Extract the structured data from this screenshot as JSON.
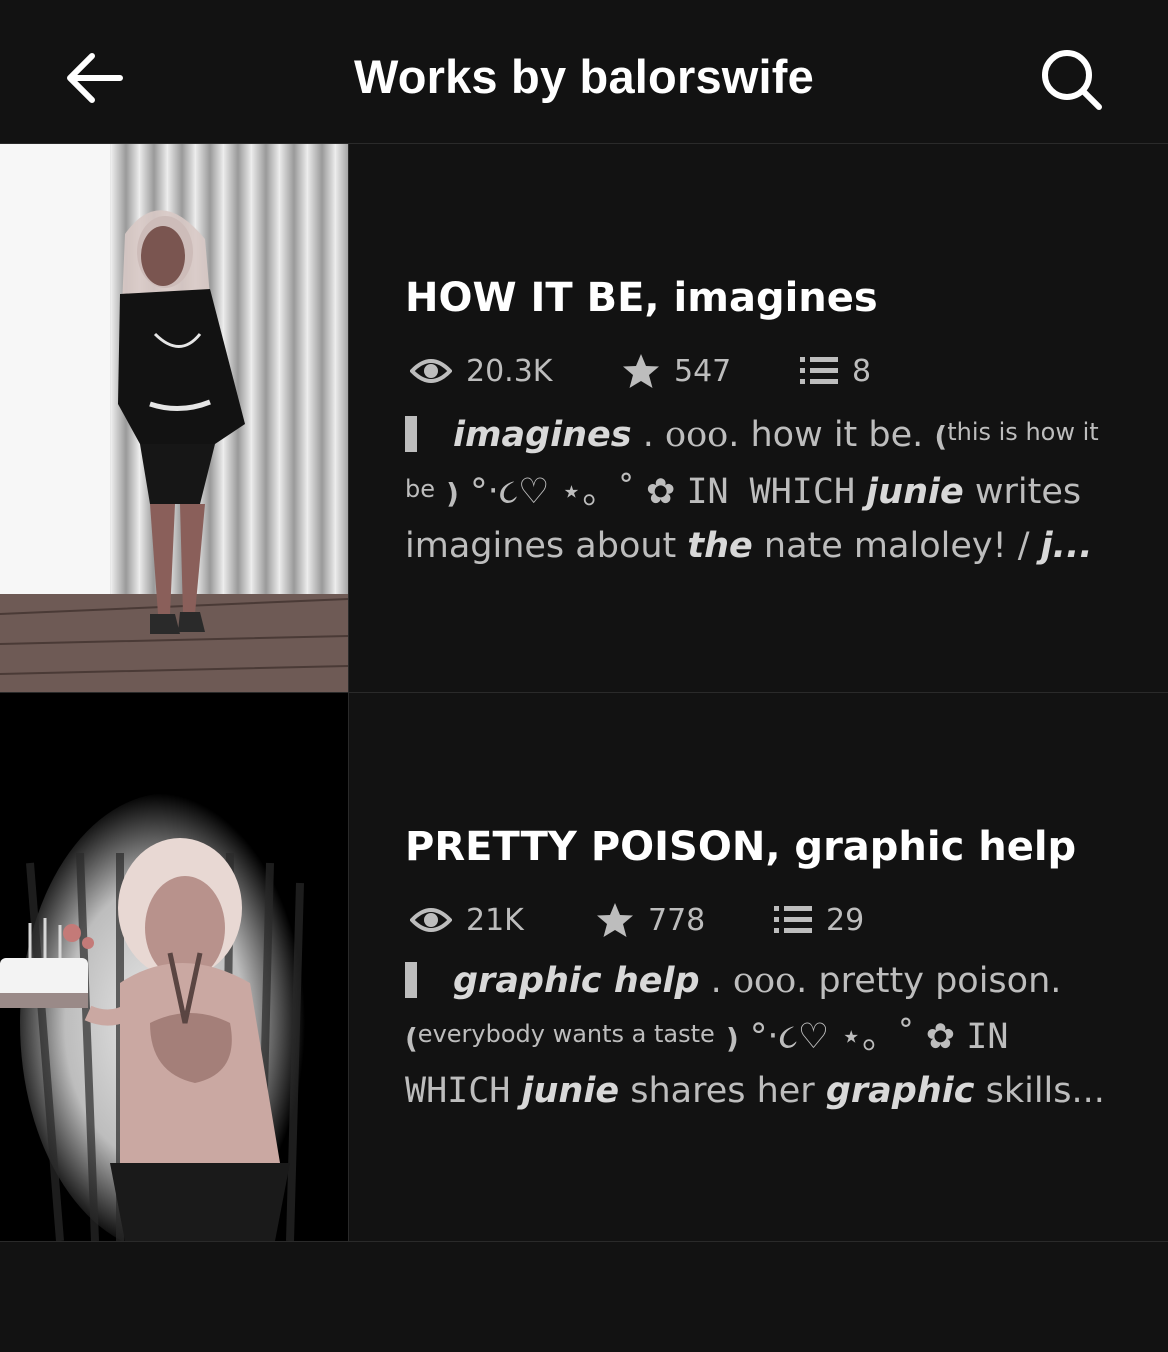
{
  "header": {
    "title": "Works by balorswife",
    "back_icon": "arrow-left-icon",
    "search_icon": "search-icon"
  },
  "stories": [
    {
      "title": "HOW IT BE, imagines",
      "reads": "20.3K",
      "votes": "547",
      "parts": "8",
      "description": {
        "tag": "imagines",
        "dot1": " . ",
        "ooo": "ooo",
        "text1": ". how it be.",
        "paren_open": "(",
        "quote": "this is how it be",
        "paren_close": ")",
        "decor": " °‧૮♡ ⋆。˚ ✿ ",
        "in_which": "IN WHICH",
        "name": "junie",
        "text2": " writes imagines about ",
        "the": "the",
        "text3": " nate maloley!  / ",
        "tail": "j..."
      }
    },
    {
      "title": "PRETTY POISON, graphic help",
      "reads": "21K",
      "votes": "778",
      "parts": "29",
      "description": {
        "tag": "graphic help",
        "dot1": " . ",
        "ooo": "ooo",
        "text1": ". pretty poison.",
        "paren_open": "(",
        "quote": "everybody wants a taste",
        "paren_close": ")",
        "decor": " °‧૮♡ ⋆。˚ ✿ ",
        "in_which": "IN WHICH",
        "name": "junie",
        "text2": " shares her ",
        "the": "graphic",
        "text3": " skills...",
        "tail": ""
      }
    }
  ],
  "colors": {
    "background": "#121212",
    "title": "#ffffff",
    "meta": "#bdbdbd",
    "divider": "#2a2a2a"
  }
}
